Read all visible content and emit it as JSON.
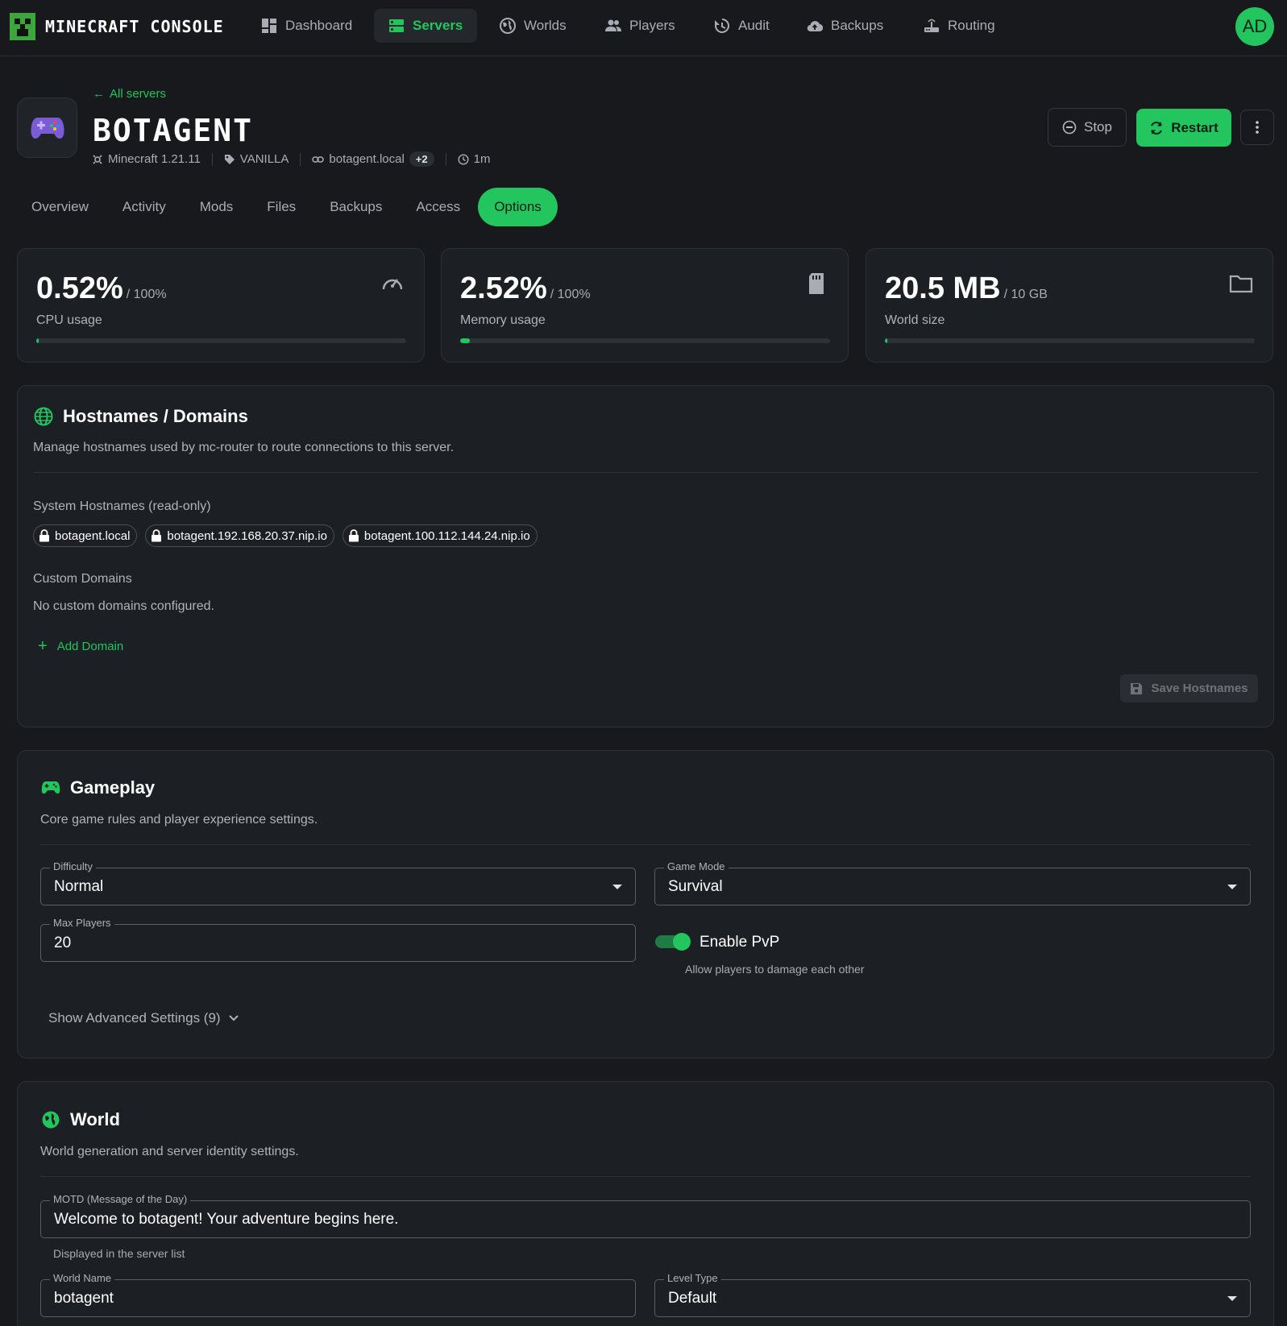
{
  "app": {
    "title": "MINECRAFT CONSOLE",
    "avatar": "AD"
  },
  "nav": [
    {
      "label": "Dashboard",
      "icon": "dashboard-icon"
    },
    {
      "label": "Servers",
      "icon": "servers-icon",
      "active": true
    },
    {
      "label": "Worlds",
      "icon": "globe-icon"
    },
    {
      "label": "Players",
      "icon": "players-icon"
    },
    {
      "label": "Audit",
      "icon": "history-icon"
    },
    {
      "label": "Backups",
      "icon": "cloud-upload-icon"
    },
    {
      "label": "Routing",
      "icon": "router-icon"
    }
  ],
  "server": {
    "back_label": "All servers",
    "name": "BOTAGENT",
    "version": "Minecraft 1.21.11",
    "type": "VANILLA",
    "host": "botagent.local",
    "host_extra": "+2",
    "uptime": "1m"
  },
  "actions": {
    "stop": "Stop",
    "restart": "Restart"
  },
  "tabs": [
    "Overview",
    "Activity",
    "Mods",
    "Files",
    "Backups",
    "Access",
    "Options"
  ],
  "active_tab": "Options",
  "stats": [
    {
      "value": "0.52%",
      "max": "/ 100%",
      "label": "CPU usage",
      "progress": 0.0052,
      "icon": "speedometer-icon"
    },
    {
      "value": "2.52%",
      "max": "/ 100%",
      "label": "Memory usage",
      "progress": 0.0252,
      "icon": "memory-card-icon"
    },
    {
      "value": "20.5 MB",
      "max": "/ 10 GB",
      "label": "World size",
      "progress": 0.002,
      "icon": "folder-icon"
    }
  ],
  "hostnames": {
    "title": "Hostnames / Domains",
    "description": "Manage hostnames used by mc-router to route connections to this server.",
    "system_label": "System Hostnames (read-only)",
    "system": [
      "botagent.local",
      "botagent.192.168.20.37.nip.io",
      "botagent.100.112.144.24.nip.io"
    ],
    "custom_label": "Custom Domains",
    "custom_empty": "No custom domains configured.",
    "add_label": "Add Domain",
    "save_label": "Save Hostnames"
  },
  "gameplay": {
    "title": "Gameplay",
    "description": "Core game rules and player experience settings.",
    "difficulty": {
      "label": "Difficulty",
      "value": "Normal"
    },
    "game_mode": {
      "label": "Game Mode",
      "value": "Survival"
    },
    "max_players": {
      "label": "Max Players",
      "value": "20"
    },
    "pvp": {
      "label": "Enable PvP",
      "helper": "Allow players to damage each other",
      "enabled": true
    },
    "advanced": "Show Advanced Settings (9)"
  },
  "world": {
    "title": "World",
    "description": "World generation and server identity settings.",
    "motd": {
      "label": "MOTD (Message of the Day)",
      "value": "Welcome to botagent! Your adventure begins here.",
      "helper": "Displayed in the server list"
    },
    "world_name": {
      "label": "World Name",
      "value": "botagent"
    },
    "level_type": {
      "label": "Level Type",
      "value": "Default"
    }
  },
  "colors": {
    "accent": "#22c55e",
    "background": "#17191c",
    "card": "#1c1f23"
  }
}
